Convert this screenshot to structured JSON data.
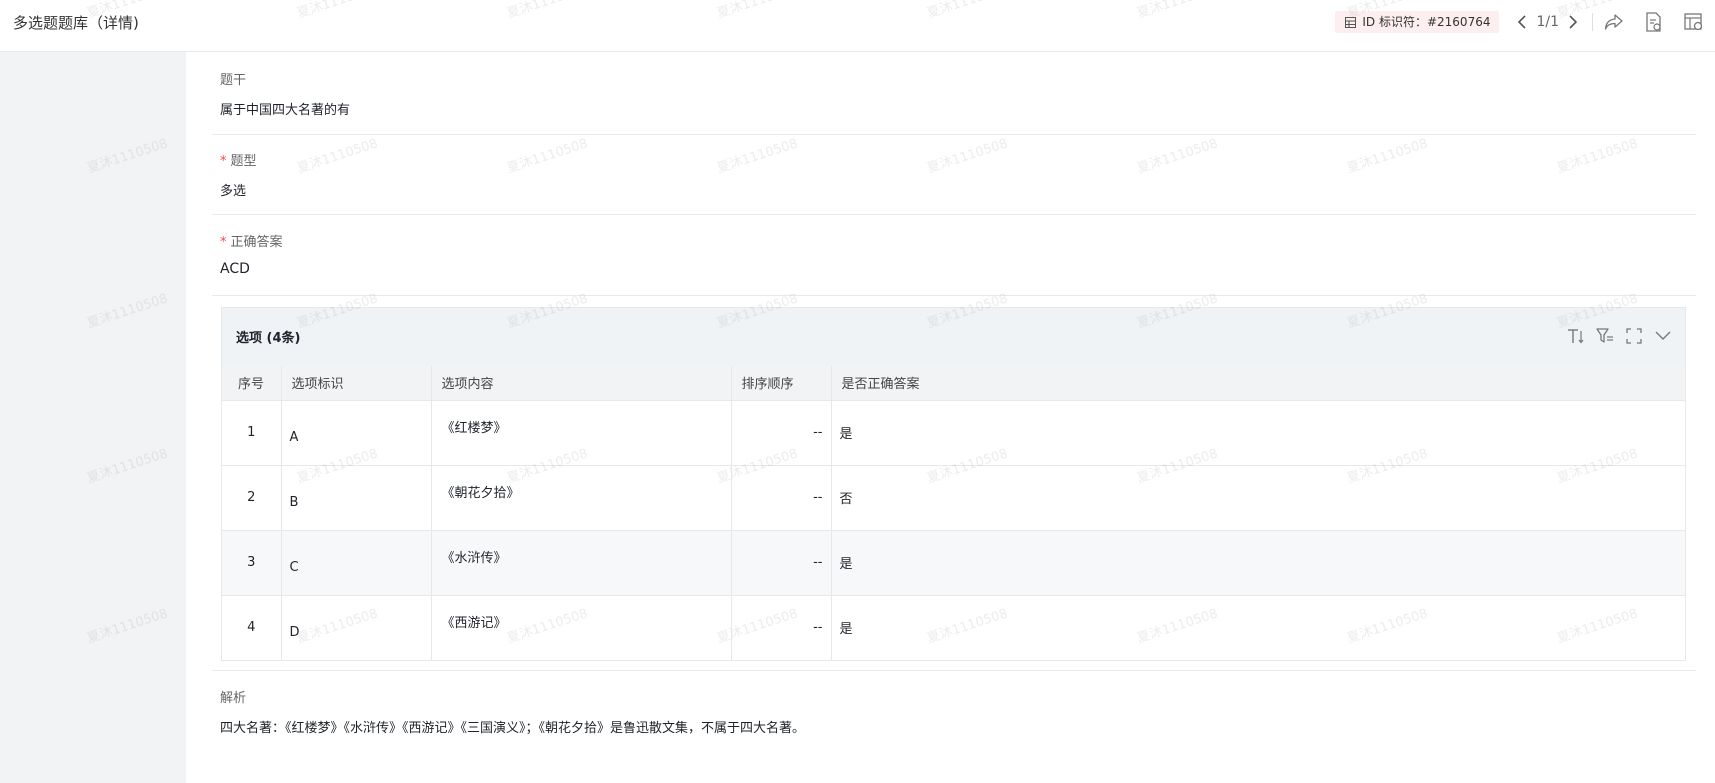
{
  "header": {
    "title": "多选题题库（详情)",
    "id_badge": "ID 标识符：#2160764",
    "pager": "1/1"
  },
  "fields": {
    "stem": {
      "label": "题干",
      "value": "属于中国四大名著的有"
    },
    "type": {
      "label": "题型",
      "value": "多选"
    },
    "answer": {
      "label": "正确答案",
      "value": "ACD"
    },
    "analysis": {
      "label": "解析",
      "value": "四大名著：《红楼梦》《水浒传》《西游记》《三国演义》；《朝花夕拾》是鲁迅散文集，不属于四大名著。"
    }
  },
  "options": {
    "title": "选项 (4条)",
    "columns": [
      "序号",
      "选项标识",
      "选项内容",
      "排序顺序",
      "是否正确答案"
    ],
    "rows": [
      {
        "no": "1",
        "label": "A",
        "content": "《红楼梦》",
        "order": "--",
        "correct": "是"
      },
      {
        "no": "2",
        "label": "B",
        "content": "《朝花夕拾》",
        "order": "--",
        "correct": "否"
      },
      {
        "no": "3",
        "label": "C",
        "content": "《水浒传》",
        "order": "--",
        "correct": "是"
      },
      {
        "no": "4",
        "label": "D",
        "content": "《西游记》",
        "order": "--",
        "correct": "是"
      }
    ]
  },
  "watermark": "夏沐1110508",
  "colors": {
    "required": "#f54a45",
    "badge_bg": "#fdeff0",
    "sidebar_bg": "#f2f3f5"
  },
  "icons": [
    "grid-icon",
    "chevron-left-icon",
    "chevron-right-icon",
    "share-icon",
    "document-icon",
    "settings-icon",
    "font-size-icon",
    "filter-icon",
    "fullscreen-icon",
    "chevron-down-icon"
  ]
}
